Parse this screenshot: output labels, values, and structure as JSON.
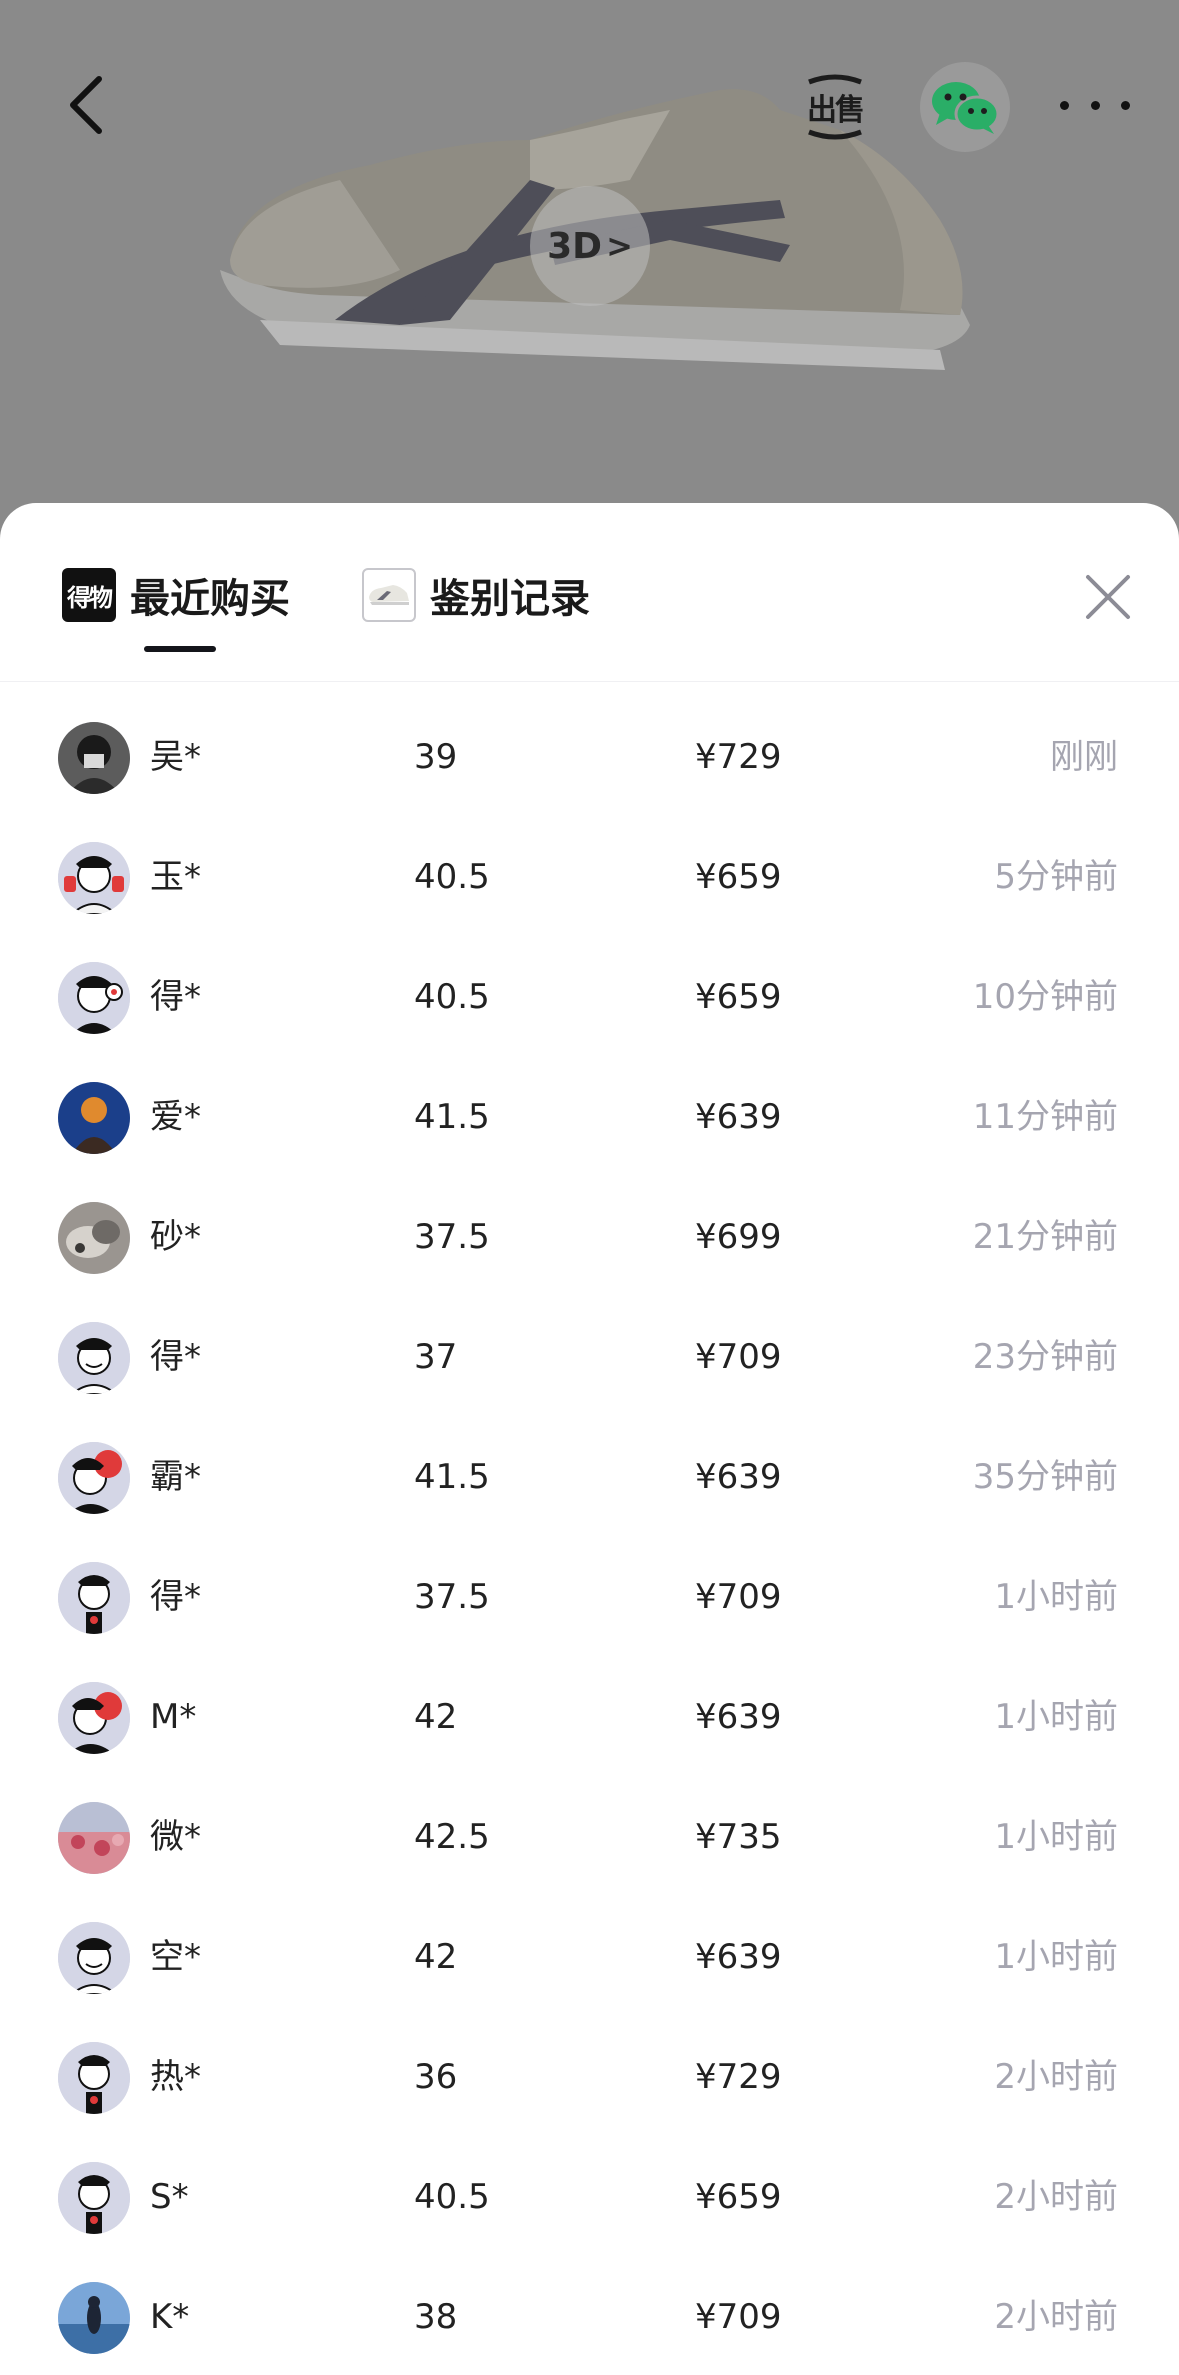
{
  "header": {
    "sell_label": "出售",
    "badge_3d": "3D",
    "badge_3d_chevron": ">"
  },
  "tabs": [
    {
      "label": "最近购买",
      "icon": "dewu-logo-icon",
      "icon_text": "得物",
      "active": true
    },
    {
      "label": "鉴别记录",
      "icon": "sneaker-thumb-icon",
      "active": false
    }
  ],
  "colors": {
    "accent": "#14151a",
    "muted_text": "#a5a5b0",
    "overlay": "#8a8a8a",
    "wechat_green": "#2aae67"
  },
  "records": [
    {
      "name": "吴*",
      "size": "39",
      "price": "¥729",
      "time": "刚刚",
      "avatar": "hooded-person-avatar"
    },
    {
      "name": "玉*",
      "size": "40.5",
      "price": "¥659",
      "time": "5分钟前",
      "avatar": "cartoon-red-avatar"
    },
    {
      "name": "得*",
      "size": "40.5",
      "price": "¥659",
      "time": "10分钟前",
      "avatar": "cartoon-default-avatar"
    },
    {
      "name": "爱*",
      "size": "41.5",
      "price": "¥639",
      "time": "11分钟前",
      "avatar": "blue-photo-avatar"
    },
    {
      "name": "砂*",
      "size": "37.5",
      "price": "¥699",
      "time": "21分钟前",
      "avatar": "cat-photo-avatar"
    },
    {
      "name": "得*",
      "size": "37",
      "price": "¥709",
      "time": "23分钟前",
      "avatar": "cartoon-default-avatar"
    },
    {
      "name": "霸*",
      "size": "41.5",
      "price": "¥639",
      "time": "35分钟前",
      "avatar": "cartoon-red-avatar"
    },
    {
      "name": "得*",
      "size": "37.5",
      "price": "¥709",
      "time": "1小时前",
      "avatar": "cartoon-default-avatar"
    },
    {
      "name": "M*",
      "size": "42",
      "price": "¥639",
      "time": "1小时前",
      "avatar": "cartoon-red-avatar"
    },
    {
      "name": "微*",
      "size": "42.5",
      "price": "¥735",
      "time": "1小时前",
      "avatar": "pink-photo-avatar"
    },
    {
      "name": "空*",
      "size": "42",
      "price": "¥639",
      "time": "1小时前",
      "avatar": "cartoon-default-avatar"
    },
    {
      "name": "热*",
      "size": "36",
      "price": "¥729",
      "time": "2小时前",
      "avatar": "cartoon-default-avatar"
    },
    {
      "name": "S*",
      "size": "40.5",
      "price": "¥659",
      "time": "2小时前",
      "avatar": "cartoon-default-avatar"
    },
    {
      "name": "K*",
      "size": "38",
      "price": "¥709",
      "time": "2小时前",
      "avatar": "beach-photo-avatar"
    }
  ]
}
